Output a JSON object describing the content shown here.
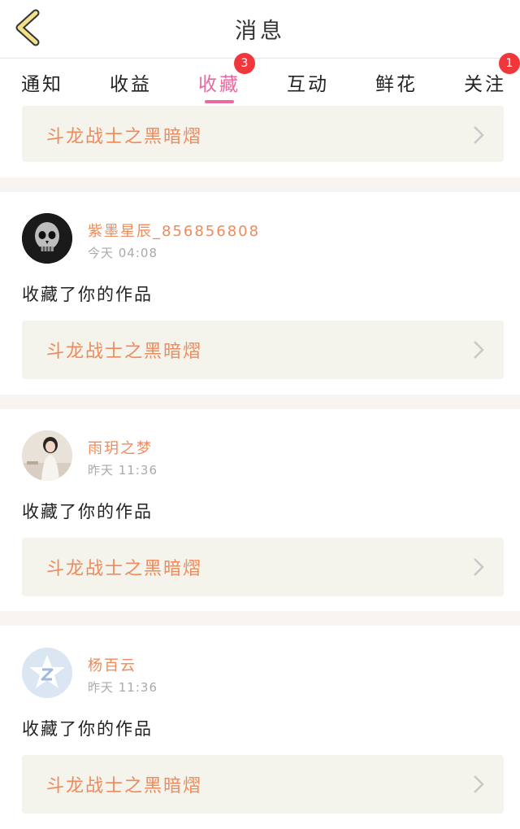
{
  "header": {
    "title": "消息",
    "back_icon": "chevron-left-icon",
    "back_color": "#f3e08a"
  },
  "tabs": [
    {
      "label": "通知",
      "badge": ""
    },
    {
      "label": "收益",
      "badge": ""
    },
    {
      "label": "收藏",
      "badge": "3"
    },
    {
      "label": "互动",
      "badge": ""
    },
    {
      "label": "鲜花",
      "badge": ""
    },
    {
      "label": "关注",
      "badge": "1"
    }
  ],
  "active_tab": "收藏",
  "colors": {
    "accent": "#e86a9e",
    "orange_text": "#ef8a5a",
    "badge": "#f0373b",
    "card_bg": "#f4f3ec"
  },
  "top_card": {
    "work_title": "斗龙战士之黑暗熠"
  },
  "messages": [
    {
      "user": "紫墨星辰_856856808",
      "time": "今天 04:08",
      "action": "收藏了你的作品",
      "work_title": "斗龙战士之黑暗熠",
      "avatar": "skull-avatar"
    },
    {
      "user": "雨玥之梦",
      "time": "昨天 11:36",
      "action": "收藏了你的作品",
      "work_title": "斗龙战士之黑暗熠",
      "avatar": "photo-avatar"
    },
    {
      "user": "杨百云",
      "time": "昨天 11:36",
      "action": "收藏了你的作品",
      "work_title": "斗龙战士之黑暗熠",
      "avatar": "default-qq-avatar"
    }
  ]
}
